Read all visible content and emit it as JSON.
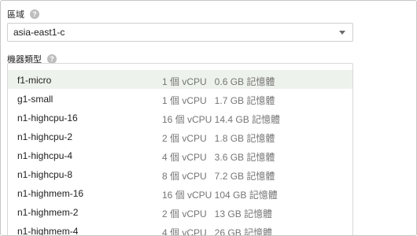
{
  "region": {
    "label": "區域",
    "help_icon": "help-circle-icon",
    "selected_value": "asia-east1-c",
    "dropdown_icon": "caret-down-icon"
  },
  "machine_type": {
    "label": "機器類型",
    "help_icon": "help-circle-icon",
    "selected_index": 0,
    "options": [
      {
        "name": "f1-micro",
        "spec": "1 個 vCPU   0.6 GB 記憶體"
      },
      {
        "name": "g1-small",
        "spec": "1 個 vCPU   1.7 GB 記憶體"
      },
      {
        "name": "n1-highcpu-16",
        "spec": "16 個 vCPU 14.4 GB 記憶體"
      },
      {
        "name": "n1-highcpu-2",
        "spec": "2 個 vCPU   1.8 GB 記憶體"
      },
      {
        "name": "n1-highcpu-4",
        "spec": "4 個 vCPU   3.6 GB 記憶體"
      },
      {
        "name": "n1-highcpu-8",
        "spec": "8 個 vCPU   7.2 GB 記憶體"
      },
      {
        "name": "n1-highmem-16",
        "spec": "16 個 vCPU 104 GB 記憶體"
      },
      {
        "name": "n1-highmem-2",
        "spec": "2 個 vCPU   13 GB 記憶體"
      },
      {
        "name": "n1-highmem-4",
        "spec": "4 個 vCPU   26 GB 記憶體"
      }
    ]
  },
  "colors": {
    "selected_row_bg": "#eef2ec",
    "secondary_text": "#757575",
    "border": "#cfcfcf"
  }
}
